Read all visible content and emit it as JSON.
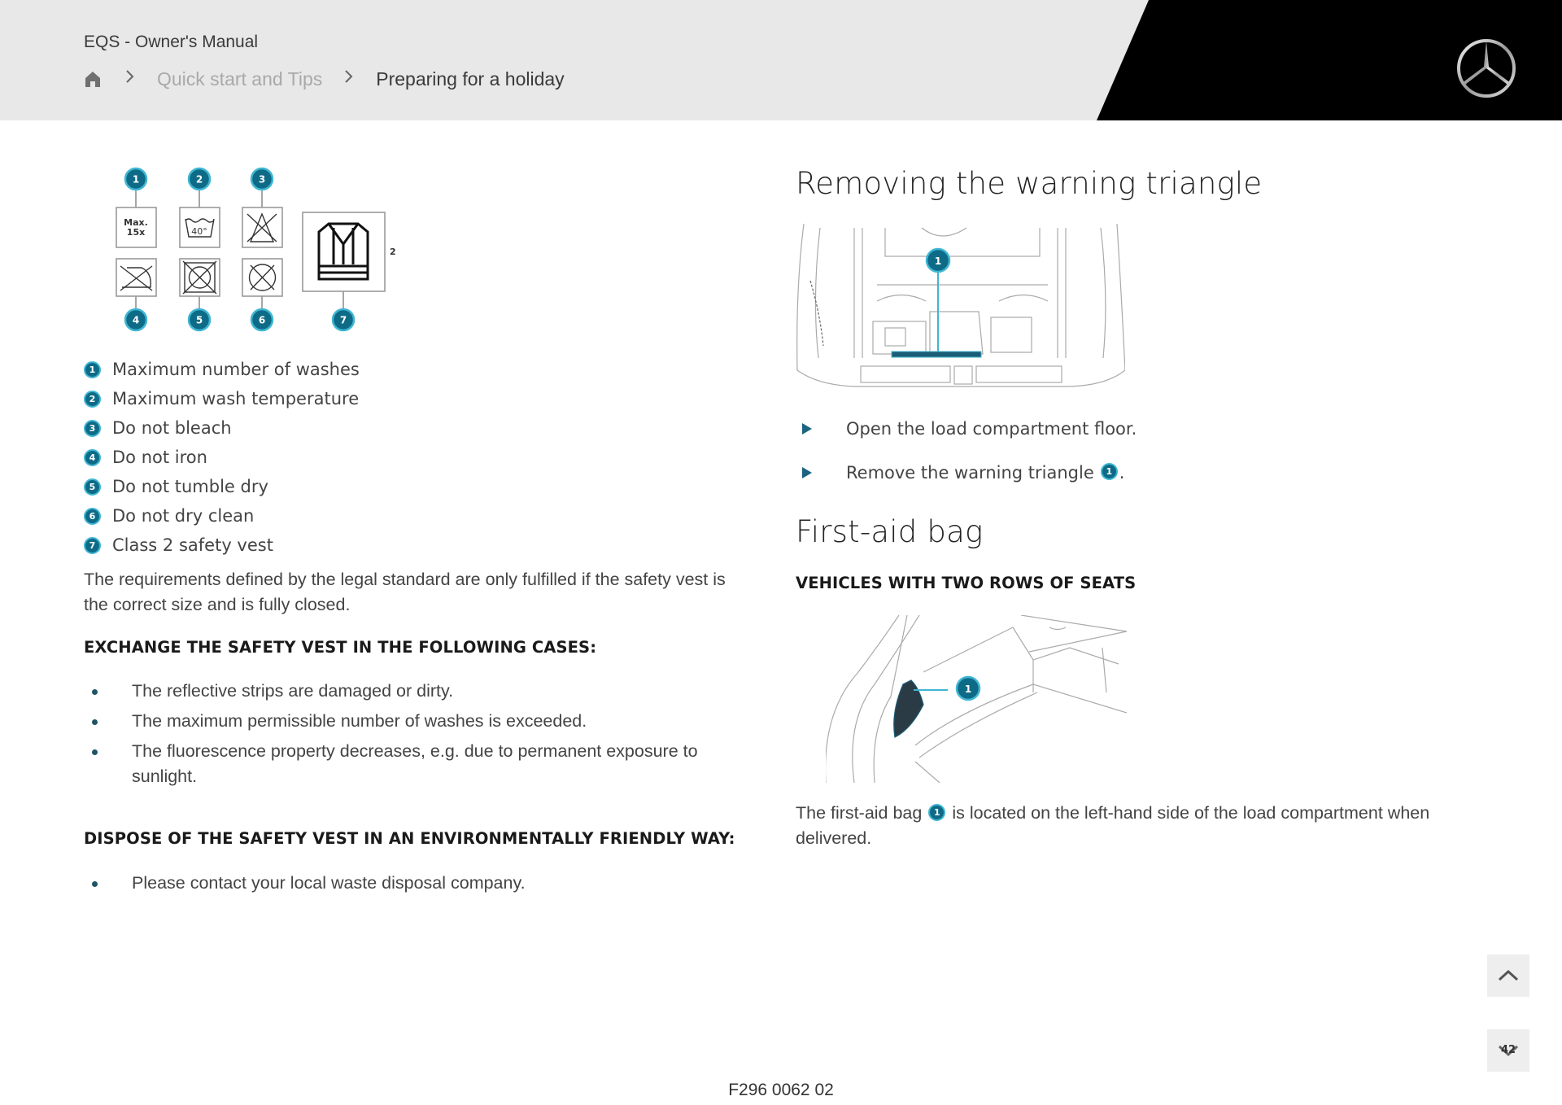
{
  "header": {
    "manual_title": "EQS - Owner's Manual",
    "breadcrumb": {
      "home_icon": "home-icon",
      "items": [
        {
          "label": "Quick start and Tips",
          "link": true
        },
        {
          "label": "Preparing for a holiday",
          "link": false
        }
      ]
    },
    "logo": "mercedes-star-logo"
  },
  "left": {
    "care_symbols": [
      {
        "number": "1",
        "symbol": "max-washes",
        "text_line1": "Max.",
        "text_line2": "15x"
      },
      {
        "number": "2",
        "symbol": "wash-temperature",
        "text": "40°"
      },
      {
        "number": "3",
        "symbol": "no-bleach"
      },
      {
        "number": "4",
        "symbol": "no-iron"
      },
      {
        "number": "5",
        "symbol": "no-tumble-dry"
      },
      {
        "number": "6",
        "symbol": "no-dry-clean"
      },
      {
        "number": "7",
        "symbol": "safety-vest",
        "class_label": "2"
      }
    ],
    "legend": [
      {
        "number": "1",
        "label": "Maximum number of washes"
      },
      {
        "number": "2",
        "label": "Maximum wash temperature"
      },
      {
        "number": "3",
        "label": "Do not bleach"
      },
      {
        "number": "4",
        "label": "Do not iron"
      },
      {
        "number": "5",
        "label": "Do not tumble dry"
      },
      {
        "number": "6",
        "label": "Do not dry clean"
      },
      {
        "number": "7",
        "label": "Class 2 safety vest"
      }
    ],
    "requirements_text": "The requirements defined by the legal standard are only fulfilled if the safety vest is the correct size and is fully closed.",
    "exchange_heading": "EXCHANGE THE SAFETY VEST IN THE FOLLOWING CASES:",
    "exchange_items": [
      "The reflective strips are damaged or dirty.",
      "The maximum permissible number of washes is exceeded.",
      "The fluorescence property decreases, e.g. due to permanent exposure to sunlight."
    ],
    "dispose_heading": "DISPOSE OF THE SAFETY VEST IN AN ENVIRONMENTALLY FRIENDLY WAY:",
    "dispose_items": [
      "Please contact your local waste disposal company."
    ]
  },
  "right": {
    "warning_triangle": {
      "title": "Removing the warning triangle",
      "figure_callout": "1",
      "steps": [
        {
          "text": "Open the load compartment floor.",
          "callout": null
        },
        {
          "text": "Remove the warning triangle",
          "callout": "1",
          "suffix": "."
        }
      ]
    },
    "first_aid": {
      "title": "First-aid bag",
      "subheading": "VEHICLES WITH TWO ROWS OF SEATS",
      "figure_callout": "1",
      "text_before": "The first-aid bag",
      "callout": "1",
      "text_after": "is located on the left-hand side of the load compartment when delivered."
    }
  },
  "navigation": {
    "scroll_up_icon": "chevron-up-icon",
    "scroll_down_icon": "chevron-down-icon",
    "page_number": "42"
  },
  "footer": {
    "figure_code": "F296 0062 02"
  },
  "colors": {
    "header_bg": "#e8e8e8",
    "header_black": "#000000",
    "callout_fill": "#0e6b87",
    "callout_ring": "#3fb6d2",
    "step_arrow": "#1b6482"
  }
}
